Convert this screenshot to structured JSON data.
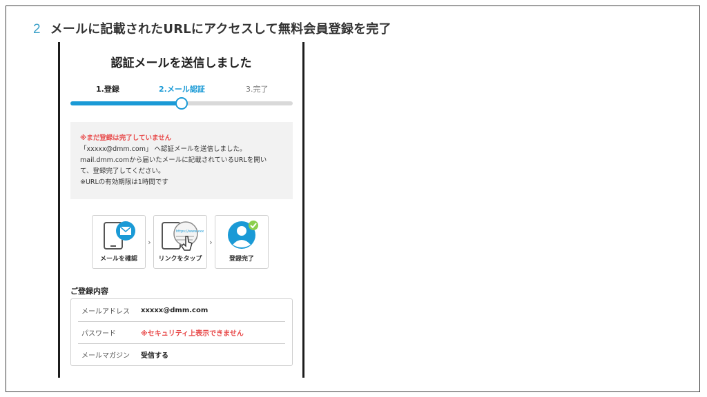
{
  "step": {
    "number": "2",
    "title": "メールに記載されたURLにアクセスして無料会員登録を完了"
  },
  "screen": {
    "title": "認証メールを送信しました",
    "steps": [
      "1.登録",
      "2.メール認証",
      "3.完了"
    ],
    "progress": 0.5,
    "notice": {
      "warning": "※まだ登録は完了していません",
      "lines": [
        "「xxxxx@dmm.com」 へ認証メールを送信しました。",
        "mail.dmm.comから届いたメールに記載されているURLを開い",
        "て、登録完了してください。",
        "※URLの有効期限は1時間です"
      ]
    },
    "flow": [
      {
        "label": "メールを確認",
        "icon": "phone-mail-icon"
      },
      {
        "label": "リンクをタップ",
        "icon": "link-tap-icon",
        "link_text": "https://www.xxx"
      },
      {
        "label": "登録完了",
        "icon": "user-check-icon"
      }
    ],
    "registration": {
      "title": "ご登録内容",
      "rows": [
        {
          "label": "メールアドレス",
          "value": "xxxxx@dmm.com"
        },
        {
          "label": "パスワード",
          "value": "※セキュリティ上表示できません"
        },
        {
          "label": "メールマガジン",
          "value": "受信する"
        }
      ]
    }
  },
  "colors": {
    "accent": "#1a9ad6",
    "warning": "#e84a4a",
    "step_number": "#3aa0c8"
  }
}
